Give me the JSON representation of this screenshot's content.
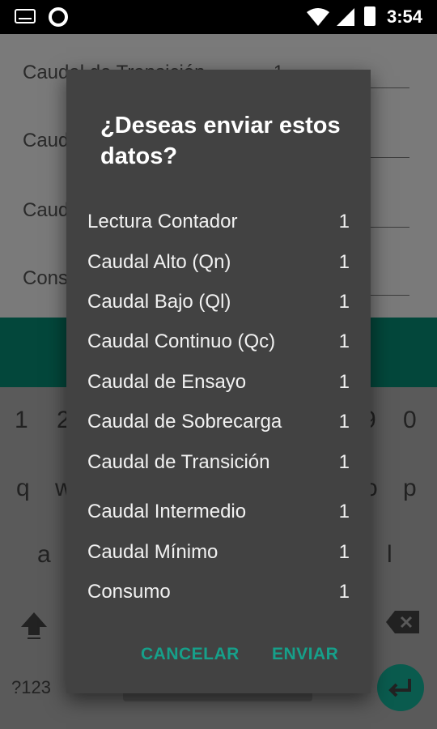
{
  "status_bar": {
    "time": "3:54"
  },
  "background_form": {
    "rows": [
      {
        "label": "Caudal de Transición",
        "value": "1"
      },
      {
        "label": "Caud"
      },
      {
        "label": "Caud"
      },
      {
        "label": "Cons"
      }
    ]
  },
  "keyboard": {
    "row_numbers": [
      "1",
      "2",
      "9",
      "0"
    ],
    "row_top": [
      "q",
      "w",
      "o",
      "p"
    ],
    "row_mid": [
      "a",
      "l"
    ],
    "symbols_key": "?123"
  },
  "dialog": {
    "title": "¿Deseas enviar estos datos?",
    "items": [
      {
        "label": "Lectura Contador",
        "value": "1"
      },
      {
        "label": "Caudal Alto (Qn)",
        "value": "1"
      },
      {
        "label": "Caudal Bajo (Ql)",
        "value": "1"
      },
      {
        "label": "Caudal Continuo (Qc)",
        "value": "1"
      },
      {
        "label": "Caudal de Ensayo",
        "value": "1"
      },
      {
        "label": "Caudal de Sobrecarga",
        "value": "1"
      },
      {
        "label": "Caudal de Transición",
        "value": "1"
      },
      {
        "label": "Caudal Intermedio",
        "value": "1"
      },
      {
        "label": "Caudal Mínimo",
        "value": "1"
      },
      {
        "label": "Consumo",
        "value": "1"
      }
    ],
    "cancel_label": "CANCELAR",
    "send_label": "ENVIAR"
  },
  "colors": {
    "accent": "#16a08a",
    "dialog_bg": "#424242",
    "app_bar": "#03473b"
  }
}
